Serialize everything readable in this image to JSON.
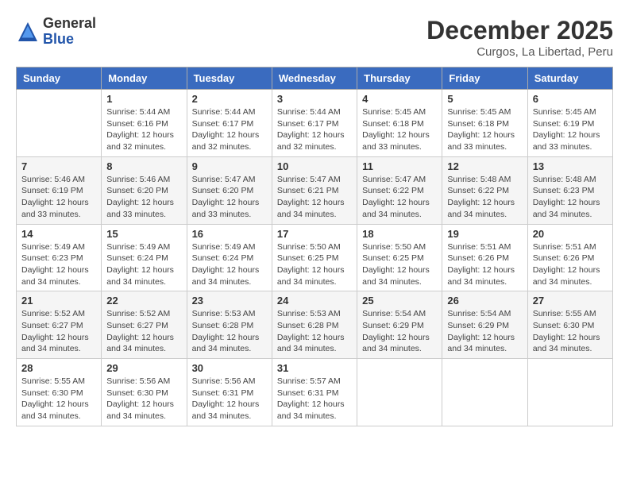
{
  "header": {
    "logo_general": "General",
    "logo_blue": "Blue",
    "month_title": "December 2025",
    "subtitle": "Curgos, La Libertad, Peru"
  },
  "days_of_week": [
    "Sunday",
    "Monday",
    "Tuesday",
    "Wednesday",
    "Thursday",
    "Friday",
    "Saturday"
  ],
  "weeks": [
    [
      {
        "day": "",
        "info": ""
      },
      {
        "day": "1",
        "info": "Sunrise: 5:44 AM\nSunset: 6:16 PM\nDaylight: 12 hours\nand 32 minutes."
      },
      {
        "day": "2",
        "info": "Sunrise: 5:44 AM\nSunset: 6:17 PM\nDaylight: 12 hours\nand 32 minutes."
      },
      {
        "day": "3",
        "info": "Sunrise: 5:44 AM\nSunset: 6:17 PM\nDaylight: 12 hours\nand 32 minutes."
      },
      {
        "day": "4",
        "info": "Sunrise: 5:45 AM\nSunset: 6:18 PM\nDaylight: 12 hours\nand 33 minutes."
      },
      {
        "day": "5",
        "info": "Sunrise: 5:45 AM\nSunset: 6:18 PM\nDaylight: 12 hours\nand 33 minutes."
      },
      {
        "day": "6",
        "info": "Sunrise: 5:45 AM\nSunset: 6:19 PM\nDaylight: 12 hours\nand 33 minutes."
      }
    ],
    [
      {
        "day": "7",
        "info": "Sunrise: 5:46 AM\nSunset: 6:19 PM\nDaylight: 12 hours\nand 33 minutes."
      },
      {
        "day": "8",
        "info": "Sunrise: 5:46 AM\nSunset: 6:20 PM\nDaylight: 12 hours\nand 33 minutes."
      },
      {
        "day": "9",
        "info": "Sunrise: 5:47 AM\nSunset: 6:20 PM\nDaylight: 12 hours\nand 33 minutes."
      },
      {
        "day": "10",
        "info": "Sunrise: 5:47 AM\nSunset: 6:21 PM\nDaylight: 12 hours\nand 34 minutes."
      },
      {
        "day": "11",
        "info": "Sunrise: 5:47 AM\nSunset: 6:22 PM\nDaylight: 12 hours\nand 34 minutes."
      },
      {
        "day": "12",
        "info": "Sunrise: 5:48 AM\nSunset: 6:22 PM\nDaylight: 12 hours\nand 34 minutes."
      },
      {
        "day": "13",
        "info": "Sunrise: 5:48 AM\nSunset: 6:23 PM\nDaylight: 12 hours\nand 34 minutes."
      }
    ],
    [
      {
        "day": "14",
        "info": "Sunrise: 5:49 AM\nSunset: 6:23 PM\nDaylight: 12 hours\nand 34 minutes."
      },
      {
        "day": "15",
        "info": "Sunrise: 5:49 AM\nSunset: 6:24 PM\nDaylight: 12 hours\nand 34 minutes."
      },
      {
        "day": "16",
        "info": "Sunrise: 5:49 AM\nSunset: 6:24 PM\nDaylight: 12 hours\nand 34 minutes."
      },
      {
        "day": "17",
        "info": "Sunrise: 5:50 AM\nSunset: 6:25 PM\nDaylight: 12 hours\nand 34 minutes."
      },
      {
        "day": "18",
        "info": "Sunrise: 5:50 AM\nSunset: 6:25 PM\nDaylight: 12 hours\nand 34 minutes."
      },
      {
        "day": "19",
        "info": "Sunrise: 5:51 AM\nSunset: 6:26 PM\nDaylight: 12 hours\nand 34 minutes."
      },
      {
        "day": "20",
        "info": "Sunrise: 5:51 AM\nSunset: 6:26 PM\nDaylight: 12 hours\nand 34 minutes."
      }
    ],
    [
      {
        "day": "21",
        "info": "Sunrise: 5:52 AM\nSunset: 6:27 PM\nDaylight: 12 hours\nand 34 minutes."
      },
      {
        "day": "22",
        "info": "Sunrise: 5:52 AM\nSunset: 6:27 PM\nDaylight: 12 hours\nand 34 minutes."
      },
      {
        "day": "23",
        "info": "Sunrise: 5:53 AM\nSunset: 6:28 PM\nDaylight: 12 hours\nand 34 minutes."
      },
      {
        "day": "24",
        "info": "Sunrise: 5:53 AM\nSunset: 6:28 PM\nDaylight: 12 hours\nand 34 minutes."
      },
      {
        "day": "25",
        "info": "Sunrise: 5:54 AM\nSunset: 6:29 PM\nDaylight: 12 hours\nand 34 minutes."
      },
      {
        "day": "26",
        "info": "Sunrise: 5:54 AM\nSunset: 6:29 PM\nDaylight: 12 hours\nand 34 minutes."
      },
      {
        "day": "27",
        "info": "Sunrise: 5:55 AM\nSunset: 6:30 PM\nDaylight: 12 hours\nand 34 minutes."
      }
    ],
    [
      {
        "day": "28",
        "info": "Sunrise: 5:55 AM\nSunset: 6:30 PM\nDaylight: 12 hours\nand 34 minutes."
      },
      {
        "day": "29",
        "info": "Sunrise: 5:56 AM\nSunset: 6:30 PM\nDaylight: 12 hours\nand 34 minutes."
      },
      {
        "day": "30",
        "info": "Sunrise: 5:56 AM\nSunset: 6:31 PM\nDaylight: 12 hours\nand 34 minutes."
      },
      {
        "day": "31",
        "info": "Sunrise: 5:57 AM\nSunset: 6:31 PM\nDaylight: 12 hours\nand 34 minutes."
      },
      {
        "day": "",
        "info": ""
      },
      {
        "day": "",
        "info": ""
      },
      {
        "day": "",
        "info": ""
      }
    ]
  ]
}
